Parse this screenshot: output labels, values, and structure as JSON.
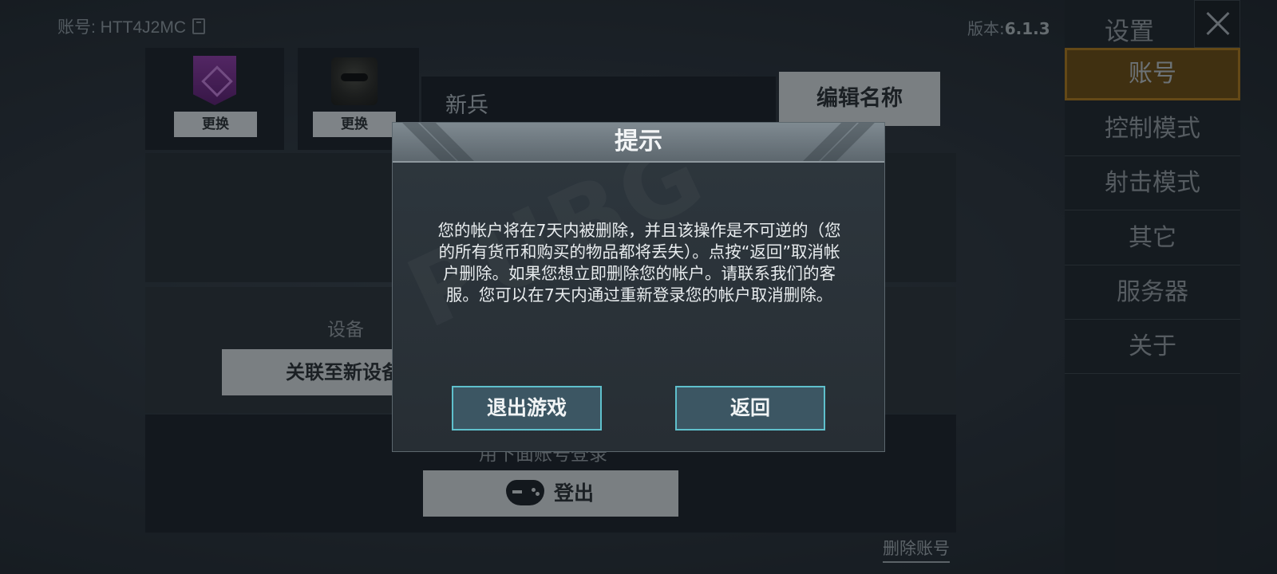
{
  "header": {
    "account_id": "账号: HTT4J2MC",
    "version_label": "版本:",
    "version_value": "6.1.3"
  },
  "profile": {
    "emblem_change_label": "更换",
    "avatar_change_label": "更换",
    "player_name": "新兵",
    "edit_name_label": "编辑名称"
  },
  "device": {
    "label": "设备",
    "link_button_label": "关联至新设备"
  },
  "login": {
    "caption": "用下面账号登录",
    "logout_label": "登出"
  },
  "delete_account_label": "删除账号",
  "settings_menu": {
    "title": "设置",
    "items": [
      {
        "label": "账号",
        "active": true
      },
      {
        "label": "控制模式",
        "active": false
      },
      {
        "label": "射击模式",
        "active": false
      },
      {
        "label": "其它",
        "active": false
      },
      {
        "label": "服务器",
        "active": false
      },
      {
        "label": "关于",
        "active": false
      }
    ]
  },
  "dialog": {
    "title": "提示",
    "message": "您的帐户将在7天内被删除，并且该操作是不可逆的（您的所有货币和购买的物品都将丢失）。点按“返回”取消帐户删除。如果您想立即删除您的帐户。请联系我们的客服。您可以在7天内通过重新登录您的帐户取消删除。",
    "exit_button_label": "退出游戏",
    "back_button_label": "返回"
  },
  "colors": {
    "menu_active_bg": "#6a4a12",
    "menu_active_border": "#a8761c",
    "dialog_button_border": "#5fc0cc"
  }
}
